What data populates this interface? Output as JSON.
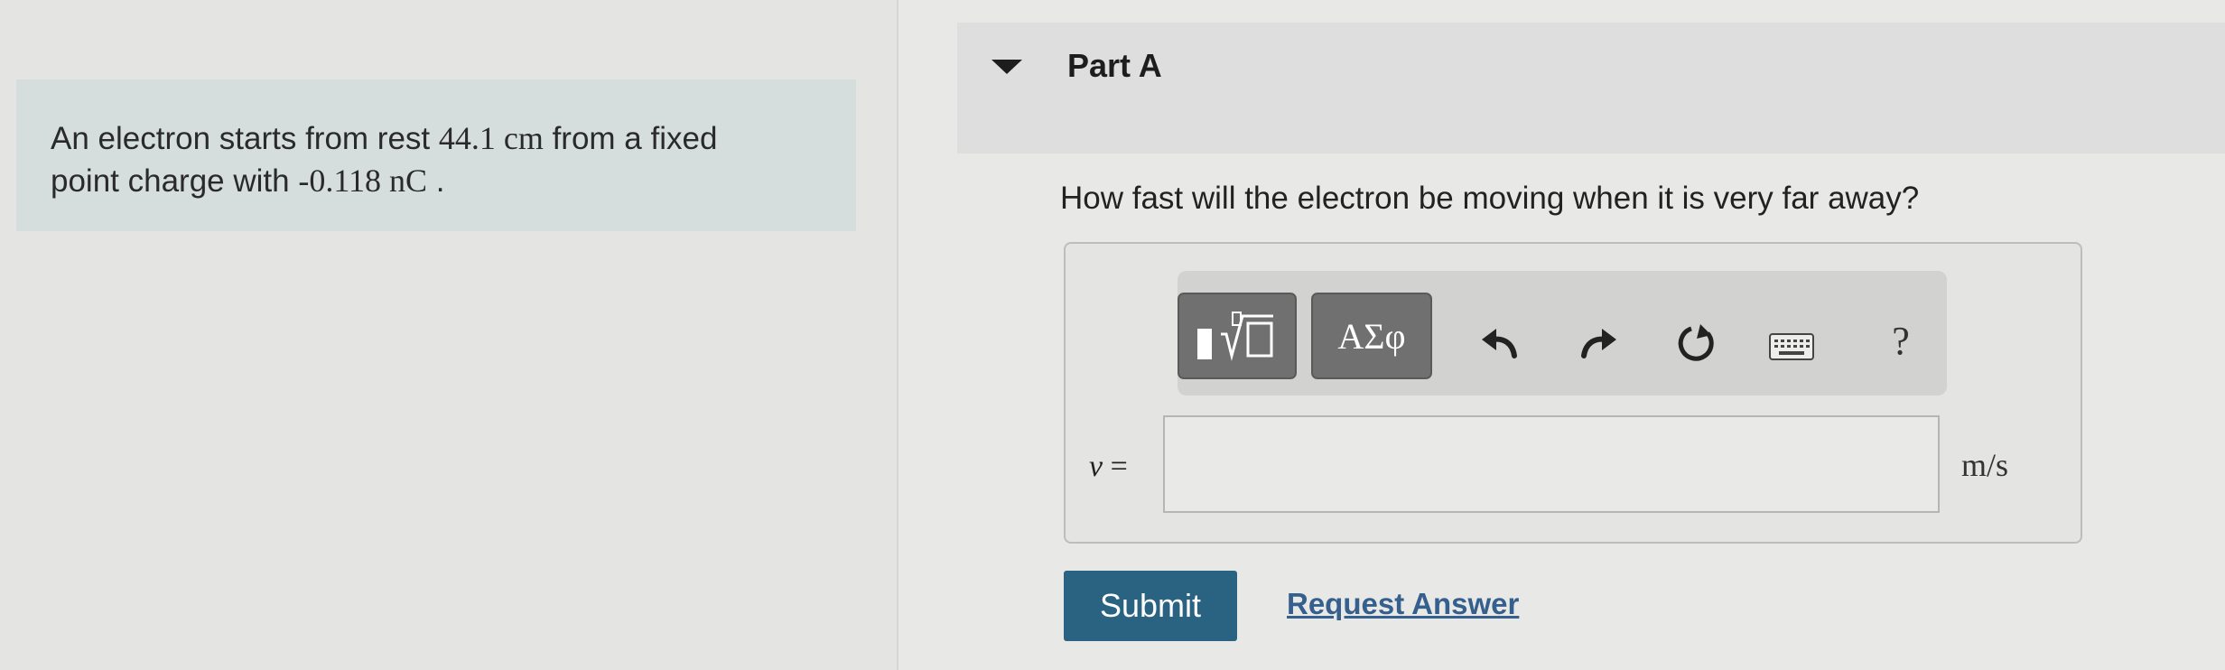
{
  "problem": {
    "line1_text": "An electron starts from rest ",
    "line1_value": "44.1 cm",
    "line1_suffix": " from a fixed",
    "line2_text": "point charge with ",
    "line2_value": "-0.118 nC",
    "line2_suffix": " ."
  },
  "part": {
    "title": "Part A",
    "question": "How fast will the electron be moving when it is very far away?"
  },
  "toolbar": {
    "symbols_label": "ΑΣφ",
    "help_label": "?",
    "icons": [
      "templates-icon",
      "undo-icon",
      "redo-icon",
      "reset-icon",
      "keyboard-icon",
      "help-icon"
    ]
  },
  "answer": {
    "variable": "v",
    "equals": " =",
    "value": "",
    "unit": "m/s"
  },
  "actions": {
    "submit_label": "Submit",
    "request_answer_label": "Request Answer"
  },
  "colors": {
    "submit_bg": "#2a6282",
    "link": "#355f8c",
    "problem_bg": "#d6dedd"
  }
}
